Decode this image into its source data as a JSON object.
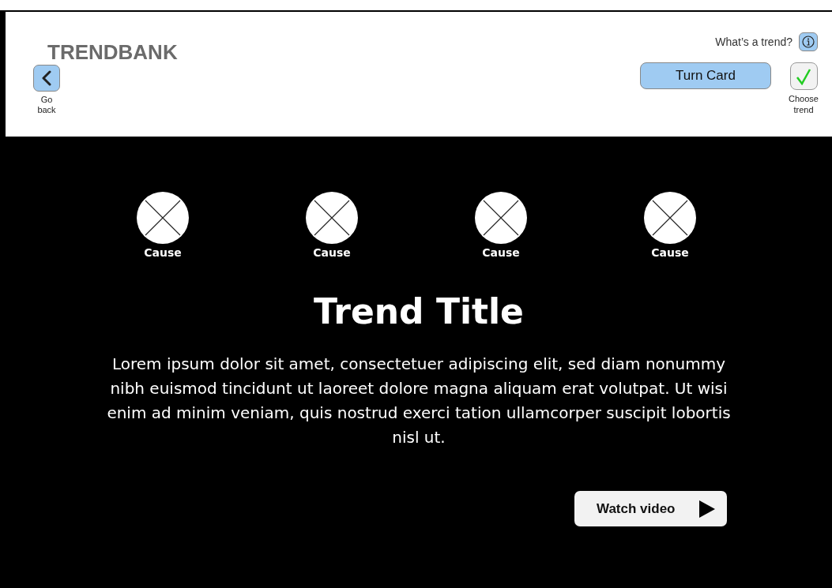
{
  "header": {
    "logo": "TRENDBANK",
    "back_button": {
      "label": "Go back"
    },
    "help_link": "What’s a trend?",
    "turn_card_button": "Turn Card",
    "choose_button": {
      "label": "Choose trend"
    }
  },
  "causes": [
    {
      "label": "Cause"
    },
    {
      "label": "Cause"
    },
    {
      "label": "Cause"
    },
    {
      "label": "Cause"
    }
  ],
  "trend": {
    "title": "Trend Title",
    "description": "Lorem ipsum dolor sit amet, consectetuer adipiscing elit, sed diam nonummy nibh euismod tincidunt ut laoreet dolore magna aliquam erat volutpat. Ut wisi enim ad minim veniam, quis nostrud exerci tation ullamcorper suscipit lobortis nisl ut."
  },
  "watch_button": "Watch video"
}
